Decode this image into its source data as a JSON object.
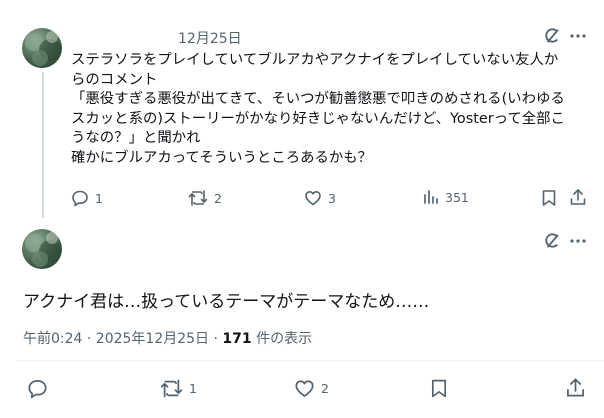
{
  "reply_tweet": {
    "date": "12月25日",
    "body": "ステラソラをプレイしていてブルアカやアクナイをプレイしていない友人か\nらのコメント\n「悪役すぎる悪役が出てきて、そいつが勧善懲悪で叩きのめされる(いわゆる\nスカッと系の)ストーリーがかなり好きじゃないんだけど、Yosterって全部こ\nうなの？」と聞かれ\n確かにブルアカってそういうところあるかも？",
    "actions": {
      "reply_count": "1",
      "retweet_count": "2",
      "like_count": "3",
      "views_count": "351"
    }
  },
  "main_tweet": {
    "body": "アクナイ君は…扱っているテーマがテーマなため……",
    "time": "午前0:24 · 2025年12月25日 · ",
    "views_number": "171",
    "views_label": " 件の表示",
    "actions": {
      "retweet_count": "1",
      "like_count": "2"
    }
  }
}
